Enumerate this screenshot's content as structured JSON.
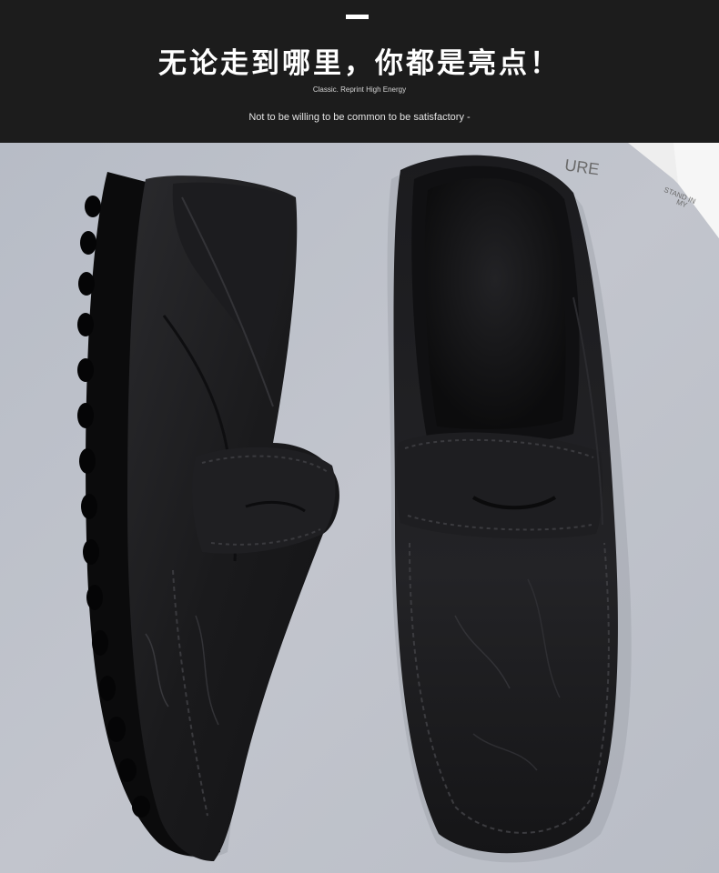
{
  "banner": {
    "headline": "无论走到哪里，你都是亮点！",
    "subtitle": "Classic. Reprint High Energy",
    "tagline": "Not to be willing to be common to be satisfactory -"
  },
  "photo": {
    "subject": "black-leather-penny-loafers",
    "background_color": "#bcc0c9",
    "box_print": {
      "word": "URE",
      "small_text_line1": "STAND IN",
      "small_text_line2": "MY"
    }
  }
}
